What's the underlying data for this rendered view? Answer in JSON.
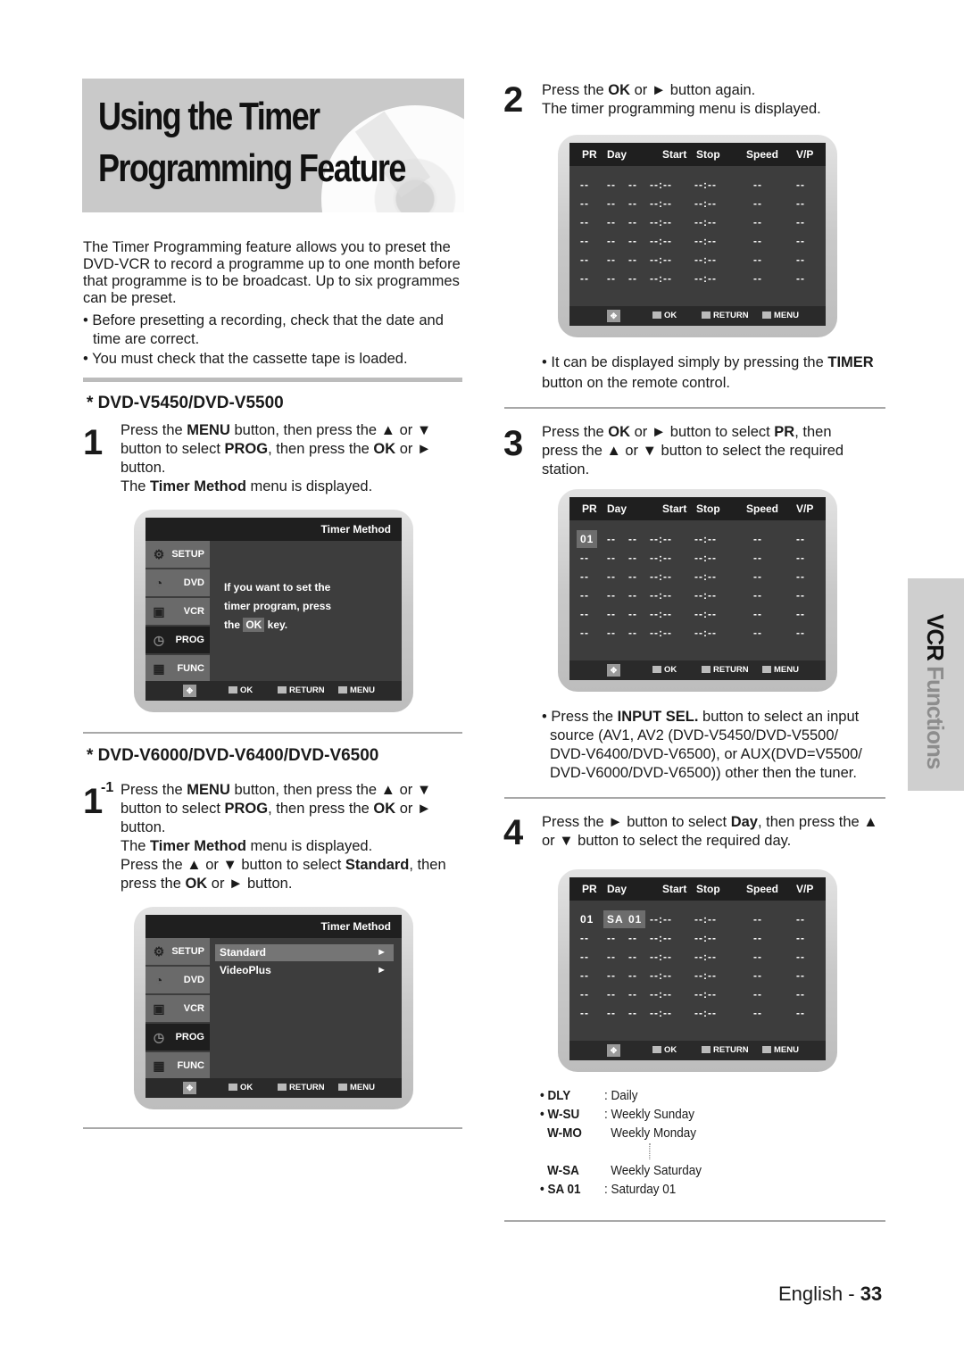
{
  "page": {
    "title_line1": "Using the Timer",
    "title_line2": "Programming Feature",
    "intro": "The Timer Programming feature allows you to preset the DVD-VCR to record a programme up to one month before that programme is to be broadcast. Up to six programmes can be preset.",
    "bullets": [
      "Before presetting a recording, check that the date and time are correct.",
      "You must check that the cassette tape is loaded."
    ],
    "side_tab": {
      "part1": "VCR ",
      "part2": "Functions"
    },
    "footer": {
      "lang": "English - ",
      "page_number": "33"
    }
  },
  "section_a": {
    "heading": "* DVD-V5450/DVD-V5500",
    "step": {
      "number": "1",
      "line1_pre": "Press the ",
      "menu": "MENU",
      "line1_post": " button, then press the ▲ or ▼",
      "line2_pre": "button to select ",
      "prog": "PROG",
      "line2_mid": ", then press the ",
      "ok": "OK",
      "line2_post": " or ►",
      "line3": "button.",
      "line4_pre": "The ",
      "timer_method": "Timer Method",
      "line4_post": " menu is displayed."
    },
    "osd": {
      "header": "Timer Method",
      "message_l1": "If you want to set the",
      "message_l2": "timer program, press",
      "message_l3_pre": "the ",
      "message_ok": "OK",
      "message_l3_post": " key."
    }
  },
  "section_b": {
    "heading": "* DVD-V6000/DVD-V6400/DVD-V6500",
    "step": {
      "number": "1",
      "sup": "-1",
      "line1_pre": "Press the ",
      "menu": "MENU",
      "line1_post": " button, then press the ▲ or ▼",
      "line2_pre": "button to select ",
      "prog": "PROG",
      "line2_mid": ", then press the ",
      "ok": "OK",
      "line2_post": " or ►",
      "line3": "button.",
      "line4_pre": "The ",
      "timer_method": "Timer Method",
      "line4_post": " menu is displayed.",
      "line5_pre": "Press the ▲ or ▼ button to select ",
      "standard": "Standard",
      "line5_post": ", then",
      "line6_pre": "press the ",
      "ok2": "OK",
      "line6_post": " or ► button."
    },
    "osd": {
      "header": "Timer Method",
      "options": [
        {
          "label": "Standard",
          "arrow": "►",
          "selected": true
        },
        {
          "label": "VideoPlus",
          "arrow": "►",
          "selected": false
        }
      ]
    }
  },
  "osd_common": {
    "side_menu": [
      {
        "label": "SETUP",
        "icon": "gear-icon",
        "glyph": "⚙"
      },
      {
        "label": "DVD",
        "icon": "dvd-icon",
        "glyph": "◔"
      },
      {
        "label": "VCR",
        "icon": "vcr-icon",
        "glyph": "▣"
      },
      {
        "label": "PROG",
        "icon": "clock-icon",
        "glyph": "◷"
      },
      {
        "label": "FUNC",
        "icon": "func-icon",
        "glyph": "▦"
      }
    ],
    "nav_glyph": "✥",
    "footer": {
      "ok": "OK",
      "return": "RETURN",
      "menu": "MENU"
    }
  },
  "timer_table": {
    "columns": [
      "PR",
      "Day",
      "Start",
      "Stop",
      "Speed",
      "V/P"
    ],
    "empty_cells": [
      "--",
      "--",
      "--",
      "--:--",
      "--:--",
      "--",
      "--"
    ]
  },
  "step2": {
    "number": "2",
    "line1_pre": "Press the ",
    "ok": "OK",
    "line1_post": " or ► button again.",
    "line2": "The timer programming menu is displayed.",
    "note_pre": "It can be displayed simply by pressing the ",
    "note_timer": "TIMER",
    "note_line2": "button on the remote control."
  },
  "step3": {
    "number": "3",
    "line1_pre": "Press the ",
    "ok": "OK",
    "line1_mid": " or ► button to select ",
    "pr": "PR",
    "line1_post": ", then",
    "line2": "press the ▲ or ▼ button to select the required",
    "line3": "station.",
    "selected_pr": "01",
    "note_pre": "Press the ",
    "note_input": "INPUT SEL.",
    "note_post": " button to select an input",
    "note_l2": "source (AV1, AV2 (DVD-V5450/DVD-V5500/",
    "note_l3": "DVD-V6400/DVD-V6500), or AUX(DVD=V5500/",
    "note_l4": "DVD-V6000/DVD-V6500)) other then the tuner."
  },
  "step4": {
    "number": "4",
    "line1_pre": "Press the ► button to select ",
    "day": "Day",
    "line1_post": ", then press the ▲",
    "line2": "or ▼ button to select the required day.",
    "row1": {
      "pr": "01",
      "day": "SA",
      "date": "01"
    },
    "legend": [
      {
        "bullet": "•",
        "key": "DLY",
        "sep": ":",
        "value": "Daily"
      },
      {
        "bullet": "•",
        "key": "W-SU",
        "sep": ":",
        "value": "Weekly Sunday"
      },
      {
        "bullet": "",
        "key": "W-MO",
        "sep": "",
        "value": "Weekly Monday"
      },
      {
        "bullet": "",
        "key": "W-SA",
        "sep": "",
        "value": "Weekly Saturday"
      },
      {
        "bullet": "•",
        "key": "SA 01",
        "sep": ":",
        "value": "Saturday 01"
      }
    ]
  }
}
